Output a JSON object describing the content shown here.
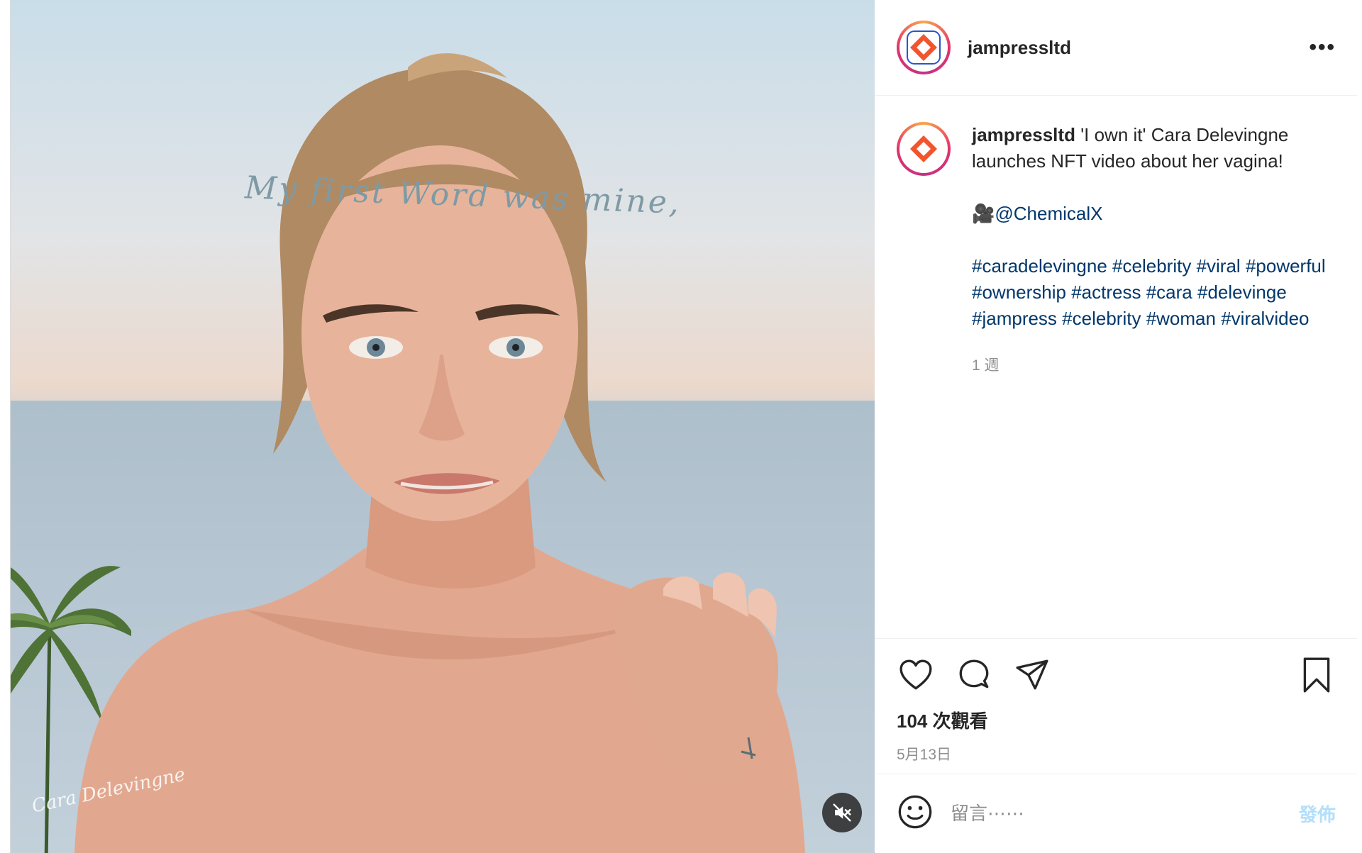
{
  "post": {
    "media": {
      "overlay_text": "My first Word was mine,",
      "signature": "Cara Delevingne",
      "mute_icon": "muted-speaker-icon"
    },
    "header": {
      "username": "jampressltd",
      "more_label": "•••"
    },
    "caption": {
      "username": "jampressltd",
      "text": "'I own it' Cara Delevingne launches NFT video about her vagina!",
      "credit_emoji": "🎥",
      "credit_mention": "@ChemicalX",
      "hashtags": [
        "#caradelevingne",
        "#celebrity",
        "#viral",
        "#powerful",
        "#ownership",
        "#actress",
        "#cara",
        "#delevinge",
        "#jampress",
        "#celebrity",
        "#woman",
        "#viralvideo"
      ],
      "time_ago": "1 週"
    },
    "actions": {
      "like_icon": "heart-icon",
      "comment_icon": "comment-bubble-icon",
      "share_icon": "paper-plane-icon",
      "save_icon": "bookmark-icon"
    },
    "views": "104 次觀看",
    "date": "5月13日",
    "comment_box": {
      "emoji_icon": "smiley-icon",
      "placeholder": "留言⋯⋯",
      "post_label": "發佈"
    }
  },
  "colors": {
    "link": "#00376b",
    "post_button_disabled": "#b2dffc",
    "muted_text": "#8e8e8e",
    "brand_orange": "#f2542d"
  }
}
